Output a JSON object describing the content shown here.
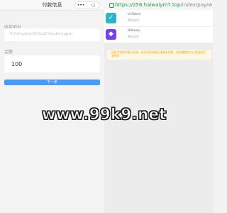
{
  "left_panel": {
    "title": "付款信息",
    "capsule": {
      "dots": "•••",
      "close": "○"
    },
    "address_label": "收款地址",
    "address_value": "TR7tHhgaKQvDTCKa4ZYXpL8xrSzgLJH",
    "amount_label": "金额",
    "amount_value": "100",
    "next_button": "下一步"
  },
  "browser": {
    "url_host": "https://256.haiwaiym7.top",
    "url_path": "/index/pay/w",
    "wallets": [
      {
        "name": "imToken",
        "status": "等待支付",
        "icon": "imtoken-icon"
      },
      {
        "name": "Bitkeep",
        "status": "等待支付",
        "icon": "bitkeep-icon"
      }
    ],
    "notice": "请在冷钱包中确认交易，若长时间未确认请联系客服，请勿重复支付以免造成资金损失"
  },
  "watermark": "www.99k9.net",
  "colors": {
    "accent": "#4a9af6",
    "green_url": "#1d9b3d",
    "notice_text": "#f6a800"
  }
}
